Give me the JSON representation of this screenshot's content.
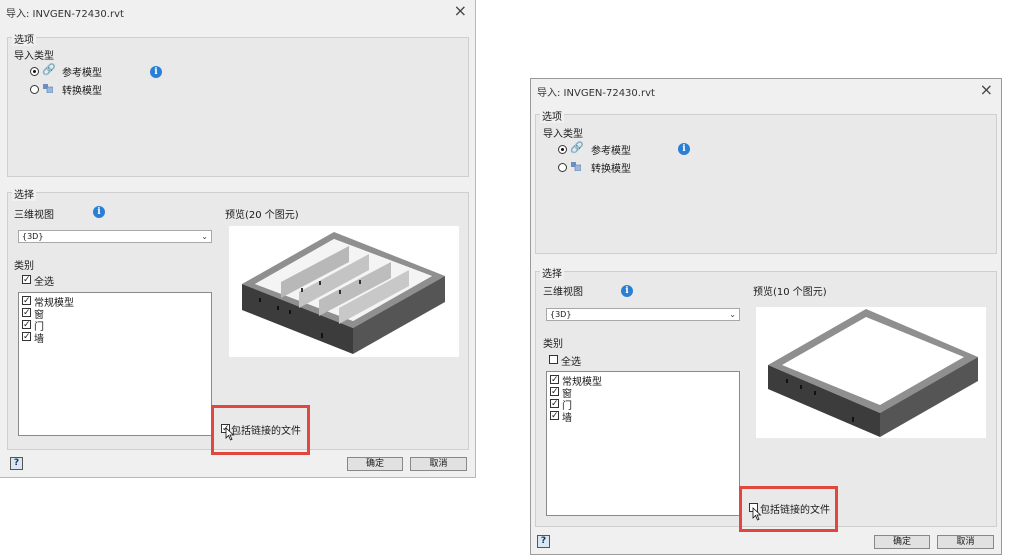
{
  "left_dialog": {
    "title": "导入: INVGEN-72430.rvt",
    "options_group": "选项",
    "import_type_label": "导入类型",
    "radio_reference": "参考模型",
    "radio_convert": "转换模型",
    "selection_group": "选择",
    "view_3d_label": "三维视图",
    "view_select_value": "{3D}",
    "preview_label": "预览(20 个图元)",
    "category_label": "类别",
    "select_all": "全选",
    "select_all_checked": true,
    "categories": [
      "常规模型",
      "窗",
      "门",
      "墙"
    ],
    "include_linked": "包括链接的文件",
    "include_linked_checked": true,
    "ok": "确定",
    "cancel": "取消",
    "help": "?"
  },
  "right_dialog": {
    "title": "导入: INVGEN-72430.rvt",
    "options_group": "选项",
    "import_type_label": "导入类型",
    "radio_reference": "参考模型",
    "radio_convert": "转换模型",
    "selection_group": "选择",
    "view_3d_label": "三维视图",
    "view_select_value": "{3D}",
    "preview_label": "预览(10 个图元)",
    "category_label": "类别",
    "select_all": "全选",
    "select_all_checked": false,
    "categories": [
      "常规模型",
      "窗",
      "门",
      "墙"
    ],
    "include_linked": "包括链接的文件",
    "include_linked_checked": false,
    "ok": "确定",
    "cancel": "取消",
    "help": "?"
  },
  "colors": {
    "highlight": "#e0473f",
    "info": "#2a7fd4",
    "link_icon": "#e07b1f",
    "wall_top": "#8f8f8f",
    "wall_side": "#3c3c3c"
  }
}
